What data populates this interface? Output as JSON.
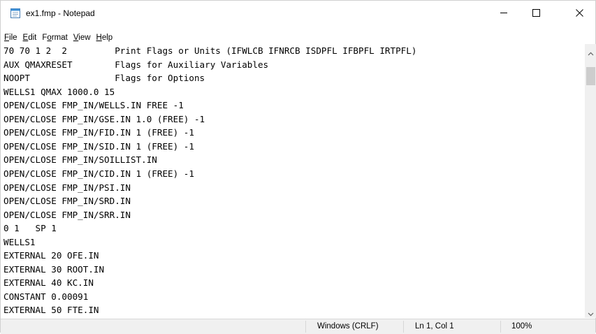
{
  "window": {
    "title": "ex1.fmp - Notepad",
    "minimize_icon": "minimize-icon",
    "maximize_icon": "maximize-icon",
    "close_icon": "close-icon"
  },
  "menu": {
    "items": [
      {
        "label": "File",
        "mnemonic_underline": "F"
      },
      {
        "label": "Edit",
        "mnemonic_underline": "E"
      },
      {
        "label": "Format",
        "mnemonic_underline": "o"
      },
      {
        "label": "View",
        "mnemonic_underline": "V"
      },
      {
        "label": "Help",
        "mnemonic_underline": "H"
      }
    ]
  },
  "editor": {
    "lines": [
      "70 70 1 2  2         Print Flags or Units (IFWLCB IFNRCB ISDPFL IFBPFL IRTPFL)",
      "AUX QMAXRESET        Flags for Auxiliary Variables",
      "NOOPT                Flags for Options",
      "WELLS1 QMAX 1000.0 15",
      "OPEN/CLOSE FMP_IN/WELLS.IN FREE -1",
      "OPEN/CLOSE FMP_IN/GSE.IN 1.0 (FREE) -1",
      "OPEN/CLOSE FMP_IN/FID.IN 1 (FREE) -1",
      "OPEN/CLOSE FMP_IN/SID.IN 1 (FREE) -1",
      "OPEN/CLOSE FMP_IN/SOILLIST.IN",
      "OPEN/CLOSE FMP_IN/CID.IN 1 (FREE) -1",
      "OPEN/CLOSE FMP_IN/PSI.IN",
      "OPEN/CLOSE FMP_IN/SRD.IN",
      "OPEN/CLOSE FMP_IN/SRR.IN",
      "0 1   SP 1",
      "WELLS1",
      "EXTERNAL 20 OFE.IN",
      "EXTERNAL 30 ROOT.IN",
      "EXTERNAL 40 KC.IN",
      "CONSTANT 0.00091",
      "EXTERNAL 50 FTE.IN"
    ]
  },
  "statusbar": {
    "line_ending": "Windows (CRLF)",
    "position": "Ln 1, Col 1",
    "zoom": "100%"
  },
  "colors": {
    "background": "#ffffff",
    "statusbar": "#f0f0f0",
    "scrollbar_track": "#f0f0f0",
    "scrollbar_thumb": "#cdcdcd",
    "icon_blue": "#3c8fd6"
  }
}
